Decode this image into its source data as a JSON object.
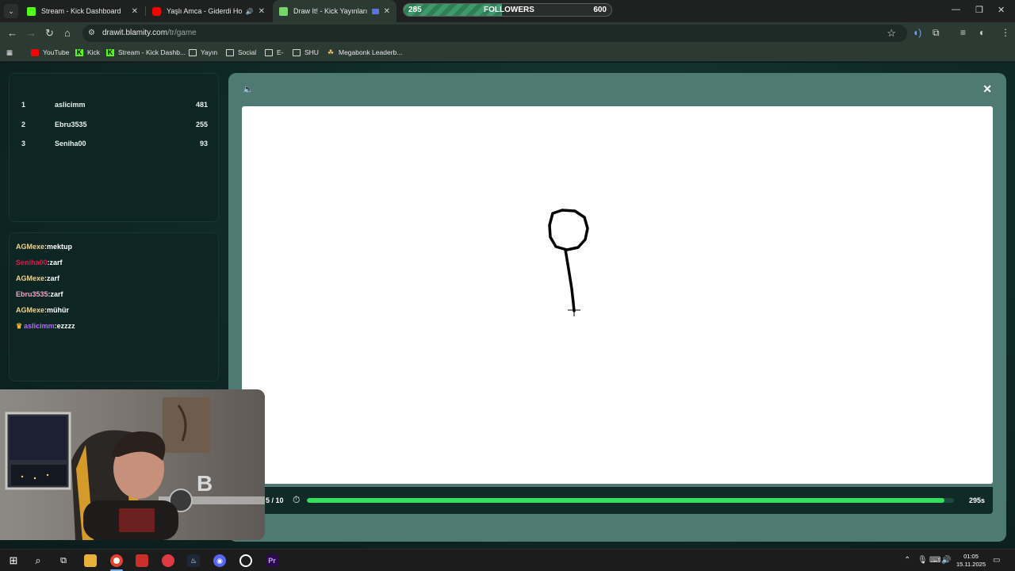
{
  "browser": {
    "tabs": [
      {
        "label": "Stream - Kick Dashboard",
        "favicon_color": "#53fc18",
        "active": false
      },
      {
        "label": "Yaşlı Amca - Giderdi Hoşum",
        "favicon_color": "#ff0000",
        "active": false
      },
      {
        "label": "Draw It! - Kick Yayınları İçin",
        "favicon_color": "#7bd36b",
        "active": true
      }
    ],
    "followers_widget": {
      "current": "285",
      "label": "FOLLOWERS",
      "goal": "600",
      "progress": 0.475
    },
    "url_host": "drawit.blamity.com",
    "url_path": "/tr/game",
    "bookmarks": [
      {
        "label": "YouTube",
        "icon": "youtube-icon"
      },
      {
        "label": "Kick",
        "icon": "kick-icon"
      },
      {
        "label": "Stream - Kick Dashb...",
        "icon": "kick-icon"
      },
      {
        "label": "Yayın",
        "icon": "folder-icon"
      },
      {
        "label": "Social",
        "icon": "folder-icon"
      },
      {
        "label": "E-",
        "icon": "folder-icon"
      },
      {
        "label": "SHU",
        "icon": "folder-icon"
      },
      {
        "label": "Megabonk Leaderb...",
        "icon": "megabonk-icon"
      }
    ]
  },
  "leaderboard": [
    {
      "rank": "1",
      "name": "aslicimm",
      "score": "481"
    },
    {
      "rank": "2",
      "name": "Ebru3535",
      "score": "255"
    },
    {
      "rank": "3",
      "name": "Seniha00",
      "score": "93"
    }
  ],
  "chat": [
    {
      "user": "AGMexe",
      "text": ":mektup",
      "color": "#f2d48c",
      "crown": false
    },
    {
      "user": "Seniha00",
      "text": ":zarf",
      "color": "#e0184a",
      "crown": false
    },
    {
      "user": "AGMexe",
      "text": ":zarf",
      "color": "#f2d48c",
      "crown": false
    },
    {
      "user": "Ebru3535",
      "text": ":zarf",
      "color": "#f0a6c8",
      "crown": false
    },
    {
      "user": "AGMexe",
      "text": ":mühür",
      "color": "#f2d48c",
      "crown": false
    },
    {
      "user": "aslicimm",
      "text": ":ezzzz",
      "color": "#b46cff",
      "crown": true
    }
  ],
  "game": {
    "round": "5 / 10",
    "time_left": "295s",
    "time_progress": 0.985
  },
  "taskbar": {
    "time": "01:05",
    "date": "15.11.2025"
  }
}
